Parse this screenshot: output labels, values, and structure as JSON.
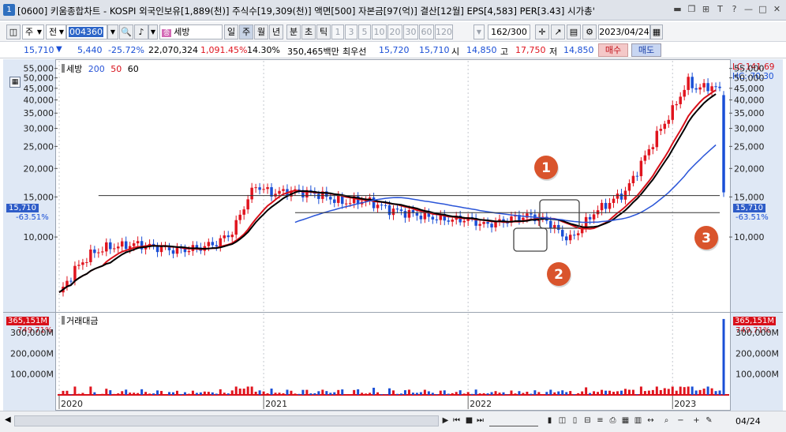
{
  "window": {
    "number": "1",
    "title": "[0600] 키움종합차트 - KOSPI 외국인보유[1,889(천)] 주식수[19,309(천)] 액면[500] 자본금[97(억)] 결산[12월] EPS[4,583] PER[3.43] 시가총'"
  },
  "toolbar": {
    "period_type": "주",
    "market_label": "전",
    "stock_code": "004360",
    "stock_name": "세방",
    "periods": [
      "일",
      "주",
      "월",
      "년",
      "분",
      "초",
      "틱"
    ],
    "active_period": "주",
    "intervals": [
      "1",
      "3",
      "5",
      "10",
      "20",
      "30",
      "60",
      "120"
    ],
    "count_display": "162",
    "count_total": "/300",
    "date": "2023/04/24"
  },
  "quote": {
    "price": "15,710",
    "change": "5,440",
    "change_pct": "-25.72%",
    "volume": "22,070,324",
    "volume_pct": "1,091.45%",
    "turnover_pct": "14.30%",
    "trade_value": "350,465백만",
    "best_label": "최우선",
    "best_bid": "15,720",
    "best_ask": "15,710",
    "open_label": "시",
    "open": "14,850",
    "high_label": "고",
    "high": "17,750",
    "low_label": "저",
    "low": "14,850",
    "buy_label": "매수",
    "sell_label": "매도"
  },
  "legend": {
    "name": "세방",
    "ma1": "200",
    "ma2": "50",
    "ma3": "60"
  },
  "right_panel": {
    "lc": "LC:141.69",
    "hc": "HC:-70.30",
    "price_tag": "15,710",
    "price_pct": "-63.51%",
    "vol_tag": "365,151M",
    "vol_pct": "749.71%"
  },
  "left_panel": {
    "price_tag": "15,710",
    "price_pct": "-63.51%",
    "vol_tag": "365,151M",
    "vol_pct": "749.71%"
  },
  "volume_panel": {
    "title": "거래대금"
  },
  "annotations": [
    "1",
    "2",
    "3"
  ],
  "bottom": {
    "end_label": "04/24"
  },
  "colors": {
    "up": "#e0141e",
    "down": "#1a4fd6",
    "ma_red": "#d8101a",
    "ma_black": "#000000",
    "ma_blue": "#2a55d8",
    "annotation": "#d9542c",
    "axis_bg": "#dfe8f5"
  },
  "chart_data": {
    "type": "candlestick",
    "price_axis": {
      "scale": "log",
      "ticks": [
        "55,000",
        "50,000",
        "45,000",
        "40,000",
        "35,000",
        "30,000",
        "25,000",
        "20,000",
        "15,000",
        "10,000"
      ],
      "tick_values": [
        55000,
        50000,
        45000,
        40000,
        35000,
        30000,
        25000,
        20000,
        15000,
        10000
      ]
    },
    "volume_axis": {
      "ticks": [
        "300,000M",
        "200,000M",
        "100,000M"
      ],
      "tick_values": [
        300000,
        200000,
        100000
      ]
    },
    "x_labels": [
      "2020",
      "2021",
      "2022",
      "2023"
    ],
    "x_label_positions_weeks": [
      0,
      52,
      104,
      156
    ],
    "weekly_close_sample": [
      [
        0,
        5600
      ],
      [
        4,
        7200
      ],
      [
        8,
        8400
      ],
      [
        12,
        9000
      ],
      [
        20,
        9300
      ],
      [
        30,
        8700
      ],
      [
        36,
        9000
      ],
      [
        40,
        9400
      ],
      [
        44,
        10500
      ],
      [
        48,
        14800
      ],
      [
        50,
        16800
      ],
      [
        54,
        15600
      ],
      [
        60,
        15900
      ],
      [
        66,
        15400
      ],
      [
        72,
        14200
      ],
      [
        78,
        14500
      ],
      [
        84,
        13200
      ],
      [
        90,
        12600
      ],
      [
        96,
        12100
      ],
      [
        100,
        11900
      ],
      [
        104,
        12000
      ],
      [
        108,
        11300
      ],
      [
        112,
        11600
      ],
      [
        116,
        12200
      ],
      [
        120,
        12400
      ],
      [
        124,
        11800
      ],
      [
        128,
        10200
      ],
      [
        130,
        9800
      ],
      [
        132,
        10600
      ],
      [
        136,
        12800
      ],
      [
        140,
        14200
      ],
      [
        144,
        15800
      ],
      [
        148,
        21000
      ],
      [
        152,
        28000
      ],
      [
        156,
        36000
      ],
      [
        158,
        42000
      ],
      [
        160,
        48000
      ],
      [
        162,
        45000
      ],
      [
        166,
        46000
      ],
      [
        168,
        44000
      ],
      [
        169,
        15710
      ]
    ],
    "horizontal_lines": [
      15200,
      12800
    ],
    "last_price": 15710,
    "last_volume_M": 365151
  }
}
